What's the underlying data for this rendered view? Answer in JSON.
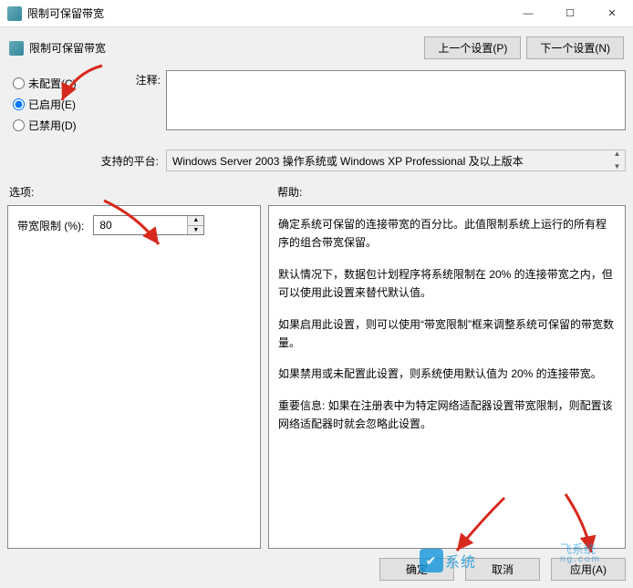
{
  "window": {
    "title": "限制可保留带宽",
    "minimize": "—",
    "maximize": "☐",
    "close": "✕"
  },
  "header": {
    "label": "限制可保留带宽",
    "prev_btn": "上一个设置(P)",
    "next_btn": "下一个设置(N)"
  },
  "config_state": {
    "not_configured": "未配置(C)",
    "enabled": "已启用(E)",
    "disabled": "已禁用(D)",
    "selected": "enabled"
  },
  "comment": {
    "label": "注释:",
    "value": ""
  },
  "platform": {
    "label": "支持的平台:",
    "value": "Windows Server 2003 操作系统或 Windows XP Professional 及以上版本"
  },
  "sections": {
    "options": "选项:",
    "help": "帮助:"
  },
  "options": {
    "bandwidth_label": "带宽限制 (%):",
    "bandwidth_value": "80"
  },
  "help": {
    "p1": "确定系统可保留的连接带宽的百分比。此值限制系统上运行的所有程序的组合带宽保留。",
    "p2": "默认情况下，数据包计划程序将系统限制在 20% 的连接带宽之内，但可以使用此设置来替代默认值。",
    "p3": "如果启用此设置，则可以使用“带宽限制”框来调整系统可保留的带宽数量。",
    "p4": "如果禁用或未配置此设置，则系统使用默认值为 20% 的连接带宽。",
    "p5": "重要信息: 如果在注册表中为特定网络适配器设置带宽限制，则配置该网络适配器时就会忽略此设置。"
  },
  "footer": {
    "ok": "确定",
    "cancel": "取消",
    "apply": "应用(A)"
  },
  "watermark": {
    "text1": "系统",
    "text2a": "飞系统",
    "text2b": " ng.com"
  },
  "arrows": {
    "color": "#d7291e"
  }
}
